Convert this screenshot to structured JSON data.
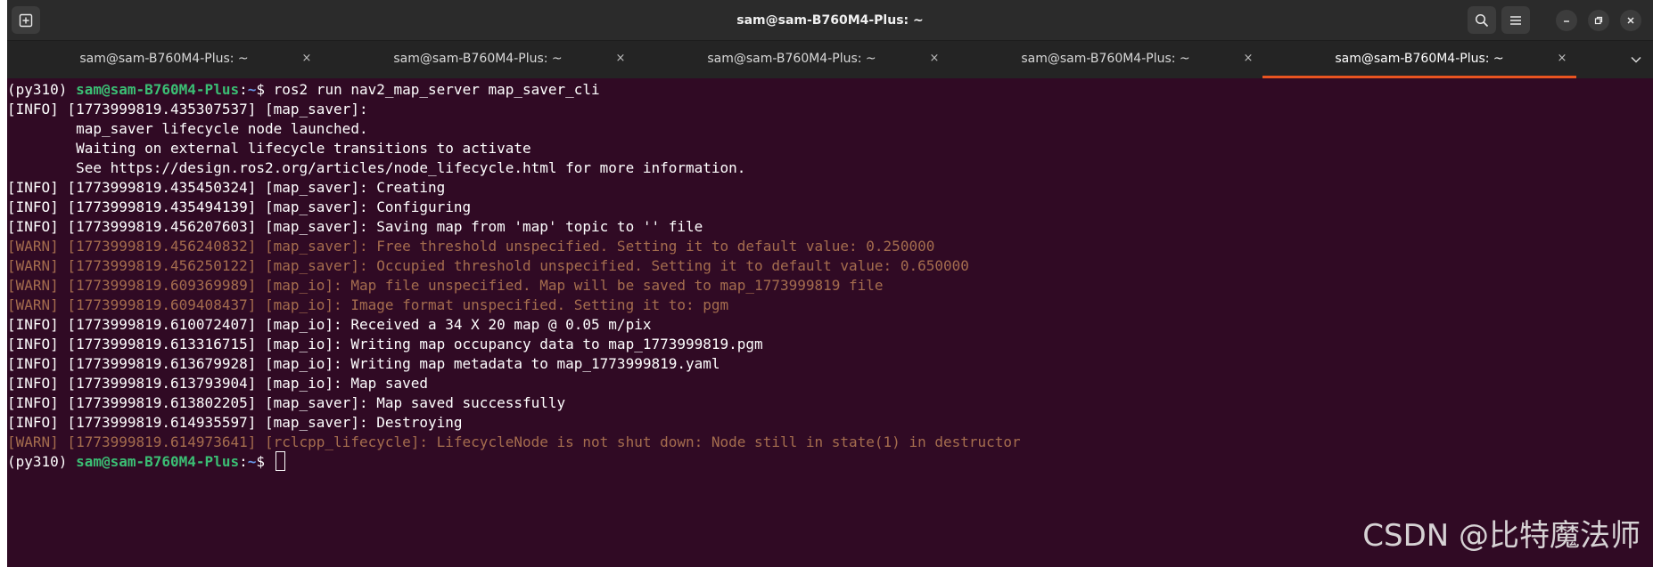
{
  "window": {
    "title": "sam@sam-B760M4-Plus: ~",
    "icons": {
      "new_tab": "new-tab-icon",
      "search": "search-icon",
      "menu": "hamburger-menu-icon",
      "minimize": "minimize-icon",
      "maximize": "restore-icon",
      "close": "close-icon"
    }
  },
  "tabs": [
    {
      "label": "sam@sam-B760M4-Plus: ~",
      "close": "×",
      "active": false
    },
    {
      "label": "sam@sam-B760M4-Plus: ~",
      "close": "×",
      "active": false
    },
    {
      "label": "sam@sam-B760M4-Plus: ~",
      "close": "×",
      "active": false
    },
    {
      "label": "sam@sam-B760M4-Plus: ~",
      "close": "×",
      "active": false
    },
    {
      "label": "sam@sam-B760M4-Plus: ~",
      "close": "×",
      "active": true
    }
  ],
  "colors": {
    "terminal_bg": "#300a24",
    "user_host": "#3bbe74",
    "path": "#6796e6",
    "warn": "#a56d4e",
    "active_tab_accent": "#e95420"
  },
  "terminal": {
    "prompt": {
      "env": "(py310) ",
      "user_host": "sam@sam-B760M4-Plus",
      "sep": ":",
      "path": "~",
      "symbol": "$ "
    },
    "command": "ros2 run nav2_map_server map_saver_cli",
    "lines": [
      {
        "level": "info",
        "text": "[INFO] [1773999819.435307537] [map_saver]:"
      },
      {
        "level": "info",
        "text": "        map_saver lifecycle node launched."
      },
      {
        "level": "info",
        "text": "        Waiting on external lifecycle transitions to activate"
      },
      {
        "level": "info",
        "text": "        See https://design.ros2.org/articles/node_lifecycle.html for more information."
      },
      {
        "level": "info",
        "text": "[INFO] [1773999819.435450324] [map_saver]: Creating"
      },
      {
        "level": "info",
        "text": "[INFO] [1773999819.435494139] [map_saver]: Configuring"
      },
      {
        "level": "info",
        "text": "[INFO] [1773999819.456207603] [map_saver]: Saving map from 'map' topic to '' file"
      },
      {
        "level": "warn",
        "text": "[WARN] [1773999819.456240832] [map_saver]: Free threshold unspecified. Setting it to default value: 0.250000"
      },
      {
        "level": "warn",
        "text": "[WARN] [1773999819.456250122] [map_saver]: Occupied threshold unspecified. Setting it to default value: 0.650000"
      },
      {
        "level": "warn",
        "text": "[WARN] [1773999819.609369989] [map_io]: Map file unspecified. Map will be saved to map_1773999819 file"
      },
      {
        "level": "warn",
        "text": "[WARN] [1773999819.609408437] [map_io]: Image format unspecified. Setting it to: pgm"
      },
      {
        "level": "info",
        "text": "[INFO] [1773999819.610072407] [map_io]: Received a 34 X 20 map @ 0.05 m/pix"
      },
      {
        "level": "info",
        "text": "[INFO] [1773999819.613316715] [map_io]: Writing map occupancy data to map_1773999819.pgm"
      },
      {
        "level": "info",
        "text": "[INFO] [1773999819.613679928] [map_io]: Writing map metadata to map_1773999819.yaml"
      },
      {
        "level": "info",
        "text": "[INFO] [1773999819.613793904] [map_io]: Map saved"
      },
      {
        "level": "info",
        "text": "[INFO] [1773999819.613802205] [map_saver]: Map saved successfully"
      },
      {
        "level": "info",
        "text": "[INFO] [1773999819.614935597] [map_saver]: Destroying"
      },
      {
        "level": "warn",
        "text": "[WARN] [1773999819.614973641] [rclcpp_lifecycle]: LifecycleNode is not shut down: Node still in state(1) in destructor"
      }
    ]
  },
  "watermark": "CSDN @比特魔法师"
}
